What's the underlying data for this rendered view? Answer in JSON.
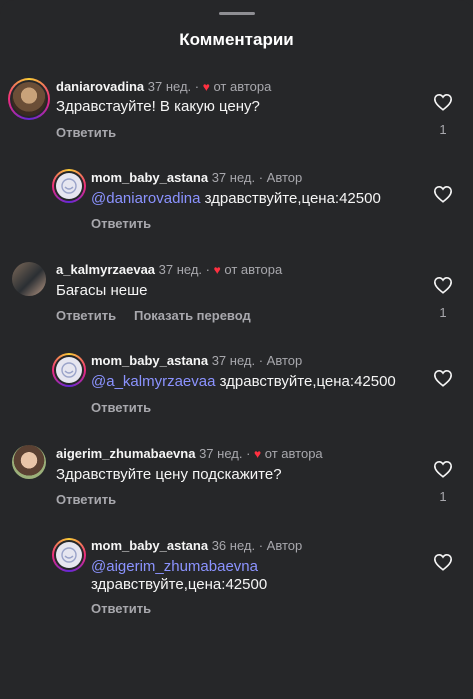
{
  "header": {
    "title": "Комментарии"
  },
  "comments": [
    {
      "user": "daniarovadina",
      "time": "37 нед.",
      "author_like": "от автора",
      "text": "Здравстауйте! В какую цену?",
      "reply": "Ответить",
      "likes": "1"
    },
    {
      "user": "mom_baby_astana",
      "time": "37 нед.",
      "author_label": "Автор",
      "mention": "@daniarovadina",
      "text": " здравствуйте,цена:42500",
      "reply": "Ответить"
    },
    {
      "user": "a_kalmyrzaevaa",
      "time": "37 нед.",
      "author_like": "от автора",
      "text": "Бағасы неше",
      "reply": "Ответить",
      "translate": "Показать перевод",
      "likes": "1"
    },
    {
      "user": "mom_baby_astana",
      "time": "37 нед.",
      "author_label": "Автор",
      "mention": "@a_kalmyrzaevaa",
      "text": " здравствуйте,цена:42500",
      "reply": "Ответить"
    },
    {
      "user": "aigerim_zhumabaevna",
      "time": "37 нед.",
      "author_like": "от автора",
      "text": "Здравствуйте цену подскажите?",
      "reply": "Ответить",
      "likes": "1"
    },
    {
      "user": "mom_baby_astana",
      "time": "36 нед.",
      "author_label": "Автор",
      "mention": "@aigerim_zhumabaevna",
      "text": "здравствуйте,цена:42500",
      "reply": "Ответить"
    }
  ],
  "colors": {
    "background": "#262729",
    "mention": "#8b93ff",
    "heart": "#ff3040",
    "muted": "#a8a8ad"
  }
}
